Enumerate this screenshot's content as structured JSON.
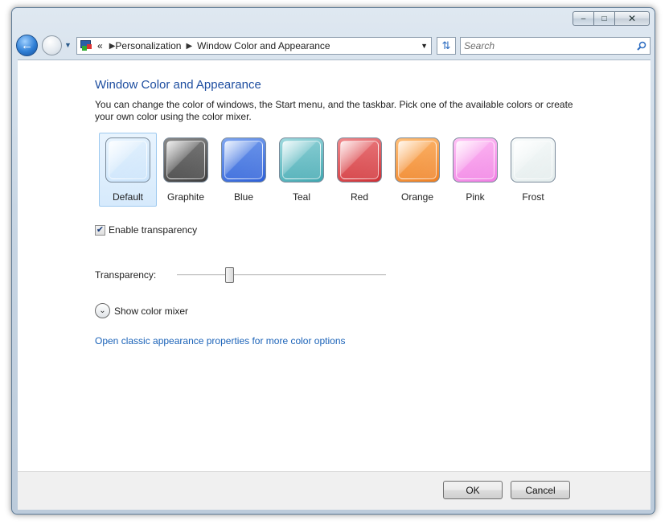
{
  "window": {
    "caption_minimize": "–",
    "caption_maximize": "□",
    "caption_close": "✕"
  },
  "nav": {
    "back_icon": "back-arrow-icon",
    "forward_icon": "forward-arrow-icon",
    "overflow": "«",
    "breadcrumbs": [
      {
        "label": "Personalization"
      },
      {
        "label": "Window Color and Appearance"
      }
    ],
    "search_placeholder": "Search"
  },
  "main": {
    "title": "Window Color and Appearance",
    "description": "You can change the color of windows, the Start menu, and the taskbar. Pick one of the available colors or create your own color using the color mixer.",
    "selected_color": "Default",
    "colors": [
      {
        "label": "Default",
        "color": "#c9e3fb",
        "color2": "#e8f4fe"
      },
      {
        "label": "Graphite",
        "color": "#3d3d3d",
        "color2": "#8a8a8a"
      },
      {
        "label": "Blue",
        "color": "#2c5fd8",
        "color2": "#7fa6f0"
      },
      {
        "label": "Teal",
        "color": "#3fa7b0",
        "color2": "#9fd9de"
      },
      {
        "label": "Red",
        "color": "#cf2f34",
        "color2": "#f08a8d"
      },
      {
        "label": "Orange",
        "color": "#ee7f22",
        "color2": "#ffc07a"
      },
      {
        "label": "Pink",
        "color": "#f07ee3",
        "color2": "#ffc4f6"
      },
      {
        "label": "Frost",
        "color": "#e3ecec",
        "color2": "#f8fbfb"
      }
    ],
    "enable_transparency_label": "Enable transparency",
    "enable_transparency_checked": true,
    "transparency_label": "Transparency:",
    "transparency_value": 0.24,
    "show_mixer_label": "Show color mixer",
    "classic_link": "Open classic appearance properties for more color options"
  },
  "footer": {
    "ok_label": "OK",
    "cancel_label": "Cancel"
  }
}
